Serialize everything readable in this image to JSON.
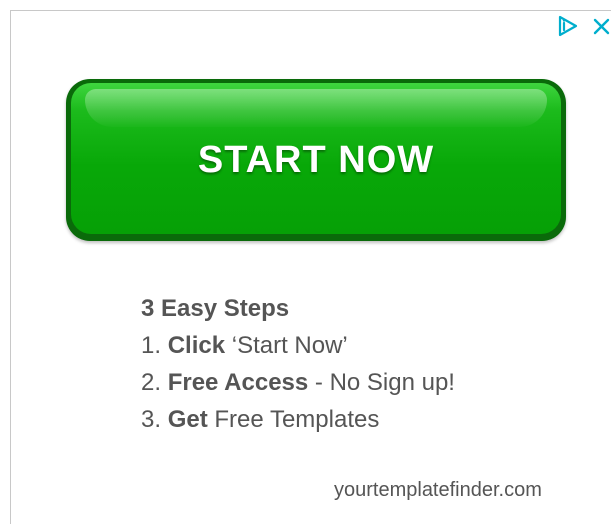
{
  "ad": {
    "cta_label": "START NOW",
    "steps_heading": "3 Easy Steps",
    "steps": [
      {
        "number": "1.",
        "bold": "Click",
        "rest": " ‘Start Now’"
      },
      {
        "number": "2.",
        "bold": "Free Access",
        "rest": " - No Sign up!"
      },
      {
        "number": "3.",
        "bold": "Get",
        "rest": " Free Templates"
      }
    ],
    "domain": "yourtemplatefinder.com"
  },
  "colors": {
    "button_green": "#08a808",
    "button_border": "#0a6a0a",
    "adchoices_blue": "#00aecd",
    "text_gray": "#555555"
  },
  "icons": {
    "adchoices": "adchoices-icon",
    "close": "close-icon"
  }
}
